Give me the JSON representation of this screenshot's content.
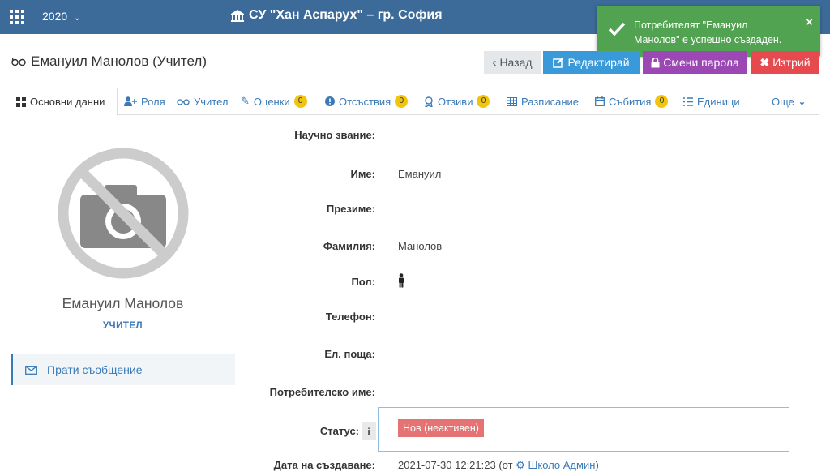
{
  "topbar": {
    "year": "2020",
    "school": "СУ \"Хан Аспарух\" – гр. София"
  },
  "toast": {
    "message": "Потребителят \"Емануил Манолов\" е успешно създаден.",
    "close": "×"
  },
  "page": {
    "title": "Емануил Манолов (Учител)"
  },
  "actions": {
    "back": "Назад",
    "edit": "Редактирай",
    "password": "Смени парола",
    "delete": "Изтрий"
  },
  "tabs": [
    {
      "label": "Основни данни"
    },
    {
      "label": "Роля"
    },
    {
      "label": "Учител"
    },
    {
      "label": "Оценки",
      "badge": "0"
    },
    {
      "label": "Отсъствия",
      "badge": "0"
    },
    {
      "label": "Отзиви",
      "badge": "0"
    },
    {
      "label": "Разписание"
    },
    {
      "label": "Събития",
      "badge": "0"
    },
    {
      "label": "Единици"
    },
    {
      "label": "Още"
    }
  ],
  "profile": {
    "name": "Емануил Манолов",
    "role": "УЧИТЕЛ",
    "send_message": "Прати съобщение"
  },
  "fields": {
    "title_label": "Научно звание:",
    "firstname_label": "Име:",
    "firstname_value": "Емануил",
    "middlename_label": "Презиме:",
    "lastname_label": "Фамилия:",
    "lastname_value": "Манолов",
    "gender_label": "Пол:",
    "phone_label": "Телефон:",
    "email_label": "Ел. поща:",
    "username_label": "Потребителско име:",
    "status_label": "Статус:",
    "status_value": "Нов (неактивен)",
    "info": "i",
    "created_label": "Дата на създаване:",
    "created_value": "2021-07-30 12:21:23 (от",
    "created_by": "Школо Админ",
    "created_close": ")"
  },
  "colors": {
    "topbar": "#3c6b9a",
    "toast": "#51a351",
    "edit": "#3a99d8",
    "password": "#9b48b5",
    "delete": "#e6494e",
    "badge": "#f1c40f",
    "status": "#e57373"
  }
}
